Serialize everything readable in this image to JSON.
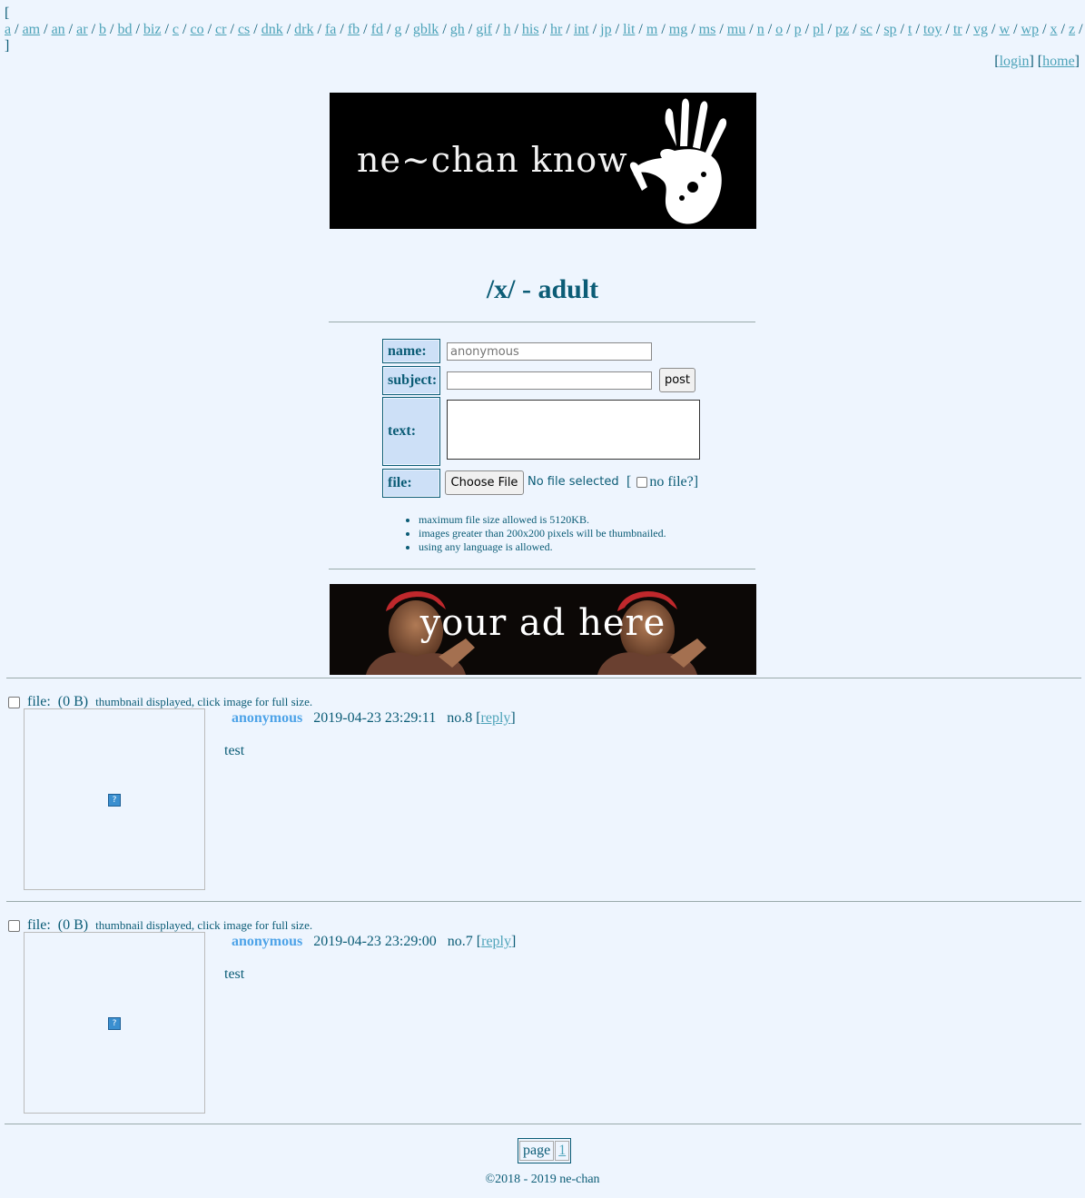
{
  "boardlist": {
    "open": "[",
    "close": "]",
    "boards": [
      "a",
      "am",
      "an",
      "ar",
      "b",
      "bd",
      "biz",
      "c",
      "co",
      "cr",
      "cs",
      "dnk",
      "drk",
      "fa",
      "fb",
      "fd",
      "g",
      "gblk",
      "gh",
      "gif",
      "h",
      "his",
      "hr",
      "int",
      "jp",
      "lit",
      "m",
      "mg",
      "ms",
      "mu",
      "n",
      "o",
      "p",
      "pl",
      "pz",
      "sc",
      "sp",
      "t",
      "toy",
      "tr",
      "vg",
      "w",
      "wp",
      "x",
      "z"
    ]
  },
  "adminbar": {
    "login": "login",
    "home": "home"
  },
  "logo": {
    "text": "ne~chan know"
  },
  "board": {
    "title": "/x/ - adult"
  },
  "form": {
    "name_label": "name:",
    "name_placeholder": "anonymous",
    "subject_label": "subject:",
    "post_button": "post",
    "text_label": "text:",
    "file_label": "file:",
    "choose_file": "Choose File",
    "no_file_selected": "No file selected",
    "no_file_label": "no file?"
  },
  "rules": [
    "maximum file size allowed is 5120KB.",
    "images greater than 200x200 pixels will be thumbnailed.",
    "using any language is allowed."
  ],
  "ad": {
    "text": "your ad here"
  },
  "posts": [
    {
      "file_label": "file:",
      "file_size": "(0 B)",
      "thumb_note": "thumbnail displayed, click image for full size.",
      "name": "anonymous",
      "date": "2019-04-23 23:29:11",
      "number": "no.8",
      "reply": "reply",
      "text": "test"
    },
    {
      "file_label": "file:",
      "file_size": "(0 B)",
      "thumb_note": "thumbnail displayed, click image for full size.",
      "name": "anonymous",
      "date": "2019-04-23 23:29:00",
      "number": "no.7",
      "reply": "reply",
      "text": "test"
    }
  ],
  "pager": {
    "label": "page",
    "pages": [
      "1"
    ]
  },
  "footer": {
    "text": "©2018 - 2019 ne-chan"
  },
  "colors": {
    "background": "#eef5fe",
    "text": "#0b5c76",
    "link": "#4da3b9",
    "name": "#4da3e8",
    "label_bg": "#cde0f7"
  }
}
